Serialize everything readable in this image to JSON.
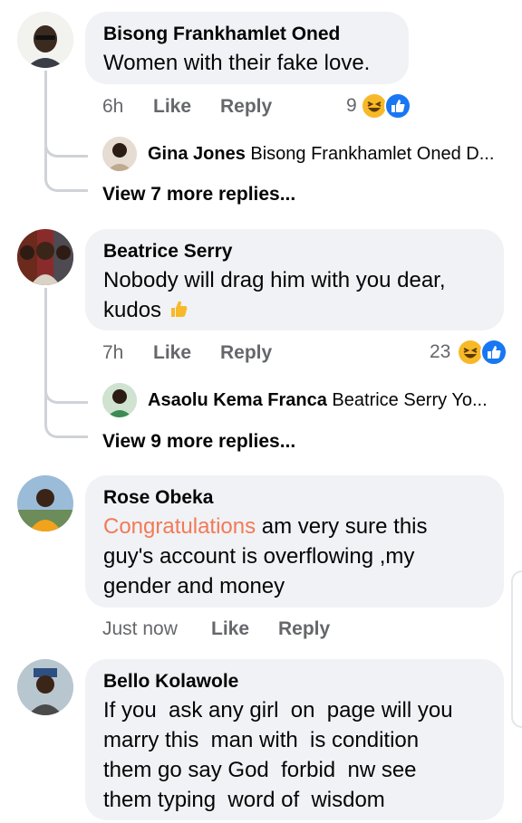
{
  "comments": [
    {
      "author": "Bisong Frankhamlet Oned",
      "text": "Women with their fake love.",
      "time": "6h",
      "like_label": "Like",
      "reply_label": "Reply",
      "reaction_count": "9",
      "reply_preview": {
        "author": "Gina Jones",
        "text": "Bisong Frankhamlet Oned D..."
      },
      "more_replies": "View 7 more replies..."
    },
    {
      "author": "Beatrice Serry",
      "text_line1": "Nobody will drag him with you dear,",
      "text_line2": "kudos",
      "time": "7h",
      "like_label": "Like",
      "reply_label": "Reply",
      "reaction_count": "23",
      "reply_preview": {
        "author": "Asaolu Kema Franca",
        "text": "Beatrice Serry Yo..."
      },
      "more_replies": "View 9 more replies..."
    },
    {
      "author": "Rose Obeka",
      "highlight": "Congratulations",
      "text_line1_rest": " am very sure this",
      "text_line2": "guy's account is overflowing ,my",
      "text_line3": "gender and money",
      "time": "Just now",
      "like_label": "Like",
      "reply_label": "Reply"
    },
    {
      "author": "Bello Kolawole",
      "text_line1": "If you  ask any girl  on  page will you",
      "text_line2": "marry this  man with  is condition",
      "text_line3": "them go say God  forbid  nw see",
      "text_line4": "them typing  word of  wisdom"
    }
  ],
  "icons": [
    "avatar",
    "haha-emoji-icon",
    "like-reaction-icon",
    "thumbs-up-emoji-icon"
  ],
  "colors": {
    "bubble": "#f0f2f5",
    "meta": "#65676b",
    "highlight": "#f27a56",
    "like_blue": "#1877f2",
    "haha_yellow": "#f7b928"
  }
}
